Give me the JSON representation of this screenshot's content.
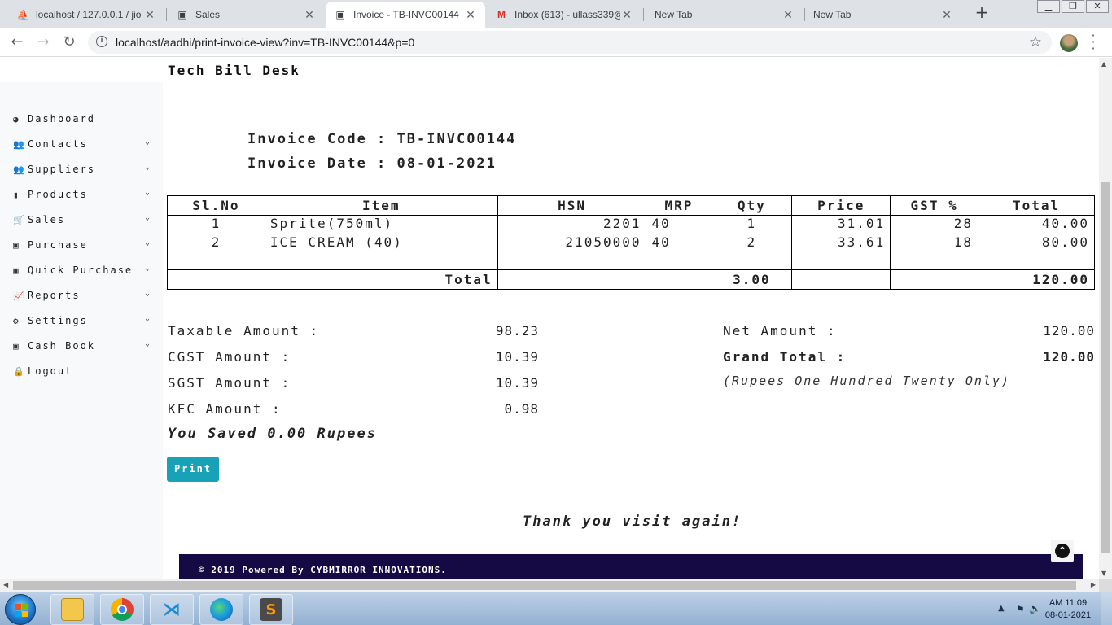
{
  "browser": {
    "tabs": [
      {
        "title": "localhost / 127.0.0.1 / jio",
        "icon": "phpmyadmin-icon",
        "active": false
      },
      {
        "title": "Sales",
        "icon": "site-icon",
        "active": false
      },
      {
        "title": "Invoice - TB-INVC00144",
        "icon": "site-icon",
        "active": true
      },
      {
        "title": "Inbox (613) - ullass339@",
        "icon": "gmail-icon",
        "active": false
      },
      {
        "title": "New Tab",
        "icon": "",
        "active": false
      },
      {
        "title": "New Tab",
        "icon": "",
        "active": false
      }
    ],
    "url": "localhost/aadhi/print-invoice-view?inv=TB-INVC00144&p=0"
  },
  "app": {
    "title": "Tech Bill Desk"
  },
  "sidebar": {
    "items": [
      {
        "label": "Dashboard",
        "icon": "dashboard-icon",
        "has_submenu": false
      },
      {
        "label": "Contacts",
        "icon": "users-icon",
        "has_submenu": true
      },
      {
        "label": "Suppliers",
        "icon": "users-icon",
        "has_submenu": true
      },
      {
        "label": "Products",
        "icon": "book-icon",
        "has_submenu": true
      },
      {
        "label": "Sales",
        "icon": "cart-icon",
        "has_submenu": true
      },
      {
        "label": "Purchase",
        "icon": "money-icon",
        "has_submenu": true
      },
      {
        "label": "Quick Purchase",
        "icon": "money-icon",
        "has_submenu": true
      },
      {
        "label": "Reports",
        "icon": "chart-icon",
        "has_submenu": true
      },
      {
        "label": "Settings",
        "icon": "gears-icon",
        "has_submenu": true
      },
      {
        "label": "Cash Book",
        "icon": "money-icon",
        "has_submenu": true
      },
      {
        "label": "Logout",
        "icon": "lock-icon",
        "has_submenu": false
      }
    ]
  },
  "invoice": {
    "code_label": "Invoice Code :",
    "code": "TB-INVC00144",
    "date_label": "Invoice Date :",
    "date": "08-01-2021",
    "columns": [
      "Sl.No",
      "Item",
      "HSN",
      "MRP",
      "Qty",
      "Price",
      "GST %",
      "Total"
    ],
    "rows": [
      {
        "sl": "1",
        "item": "Sprite(750ml)",
        "hsn": "2201",
        "mrp": "40",
        "qty": "1",
        "price": "31.01",
        "gst": "28",
        "total": "40.00"
      },
      {
        "sl": "2",
        "item": "ICE CREAM (40)",
        "hsn": "21050000",
        "mrp": "40",
        "qty": "2",
        "price": "33.61",
        "gst": "18",
        "total": "80.00"
      }
    ],
    "total_label": "Total",
    "total_qty": "3.00",
    "total_amount": "120.00"
  },
  "summary": {
    "taxable_label": "Taxable Amount :",
    "taxable": "98.23",
    "cgst_label": "CGST Amount :",
    "cgst": "10.39",
    "sgst_label": "SGST Amount :",
    "sgst": "10.39",
    "kfc_label": "KFC Amount :",
    "kfc": "0.98",
    "net_label": "Net Amount :",
    "net": "120.00",
    "grand_label": "Grand Total :",
    "grand": "120.00",
    "in_words": "(Rupees One Hundred Twenty Only)",
    "saved": "You Saved 0.00 Rupees"
  },
  "actions": {
    "print_label": "Print"
  },
  "thanks": "Thank you visit again!",
  "footer": {
    "text": "© 2019 Powered By CYBMIRROR INNOVATIONS."
  },
  "taskbar": {
    "apps": [
      "file-explorer-icon",
      "chrome-icon",
      "vscode-icon",
      "edge-icon",
      "sublime-text-icon"
    ],
    "time": "AM 11:09",
    "date": "08-01-2021"
  },
  "colors": {
    "print_button": "#17a2b8",
    "footer_bg": "#150a43",
    "sidebar_bg": "#f8f9fa"
  }
}
